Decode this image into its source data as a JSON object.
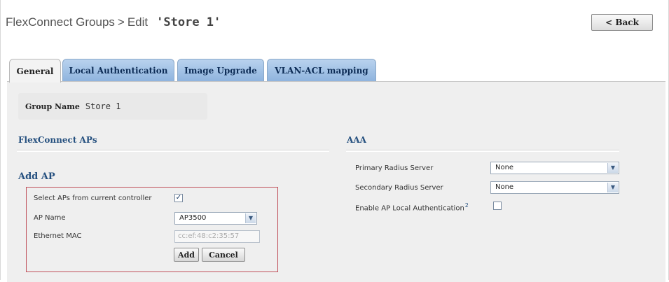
{
  "header": {
    "breadcrumb_parent": "FlexConnect Groups",
    "separator": ">",
    "action": "Edit",
    "group_name_title": "'Store 1'",
    "back_label": "< Back"
  },
  "tabs": [
    {
      "label": "General",
      "active": true
    },
    {
      "label": "Local Authentication",
      "active": false
    },
    {
      "label": "Image Upgrade",
      "active": false
    },
    {
      "label": "VLAN-ACL mapping",
      "active": false
    }
  ],
  "general": {
    "group_name_label": "Group Name",
    "group_name_value": "Store 1"
  },
  "flexconnect_aps": {
    "title": "FlexConnect APs",
    "add_ap_title": "Add AP",
    "select_from_controller_label": "Select APs from current controller",
    "select_from_controller_checked": true,
    "ap_name_label": "AP Name",
    "ap_name_value": "AP3500",
    "ethernet_mac_label": "Ethernet MAC",
    "ethernet_mac_placeholder": "cc:ef:48:c2:35:57",
    "add_label": "Add",
    "cancel_label": "Cancel"
  },
  "aaa": {
    "title": "AAA",
    "primary_label": "Primary Radius Server",
    "primary_value": "None",
    "secondary_label": "Secondary Radius Server",
    "secondary_value": "None",
    "enable_local_auth_label": "Enable AP Local Authentication",
    "help_marker": "2",
    "enable_local_auth_checked": false
  },
  "icons": {
    "dropdown": "chevron-down-icon",
    "checkbox_checked": "check-icon",
    "help": "help-icon"
  },
  "colors": {
    "tab_blue": "#8fb4de",
    "section_title": "#25507f",
    "addap_border": "#c0505a",
    "panel_bg": "#efefef"
  }
}
